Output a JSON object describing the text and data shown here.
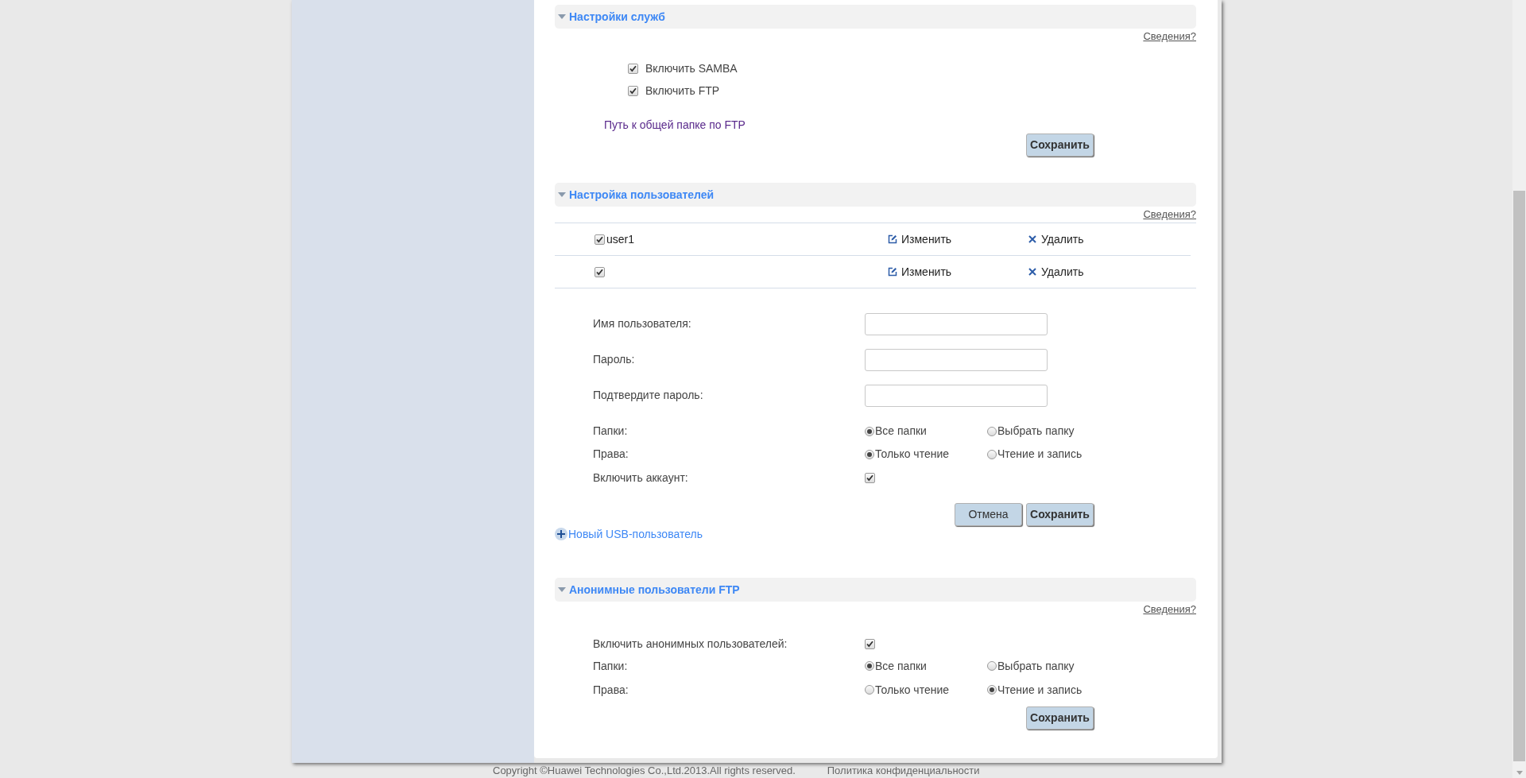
{
  "sections": [
    {
      "kind": "services",
      "title": "Настройки служб",
      "help": "Сведения?",
      "options": [
        {
          "label": "Включить SAMBA",
          "checked": true
        },
        {
          "label": "Включить FTP",
          "checked": true
        }
      ],
      "path_link": "Путь к общей папке по FTP",
      "save": "Сохранить"
    },
    {
      "kind": "users",
      "title": "Настройка пользователей",
      "help": "Сведения?",
      "users": [
        {
          "name": "user1",
          "checked": true,
          "edit": "Изменить",
          "delete": "Удалить"
        },
        {
          "checked": true,
          "edit": "Изменить",
          "delete": "Удалить"
        }
      ],
      "fields": [
        {
          "label": "Имя пользователя:"
        },
        {
          "label": "Пароль:"
        },
        {
          "label": "Подтвердите пароль:"
        }
      ],
      "radio_groups": [
        {
          "label": "Папки:",
          "options": [
            {
              "label": "Все папки",
              "selected": true
            },
            {
              "label": "Выбрать папку",
              "selected": false
            }
          ]
        },
        {
          "label": "Права:",
          "options": [
            {
              "label": "Только чтение",
              "selected": true
            },
            {
              "label": "Чтение и запись",
              "selected": false
            }
          ]
        }
      ],
      "enable": {
        "label": "Включить аккаунт:",
        "checked": true
      },
      "cancel": "Отмена",
      "save": "Сохранить",
      "add_link": "Новый USB-пользователь"
    },
    {
      "kind": "anonymous",
      "title": "Анонимные пользователи FTP",
      "help": "Сведения?",
      "enable": {
        "label": "Включить анонимных пользователей:",
        "checked": true
      },
      "radio_groups": [
        {
          "label": "Папки:",
          "options": [
            {
              "label": "Все папки",
              "selected": true
            },
            {
              "label": "Выбрать папку",
              "selected": false
            }
          ]
        },
        {
          "label": "Права:",
          "options": [
            {
              "label": "Только чтение",
              "selected": false
            },
            {
              "label": "Чтение и запись",
              "selected": true
            }
          ]
        }
      ],
      "save": "Сохранить"
    }
  ],
  "footer": {
    "copyright": "Copyright ©Huawei Technologies Co.,Ltd.2013.All rights reserved.",
    "privacy": "Политика конфиденциальности"
  }
}
